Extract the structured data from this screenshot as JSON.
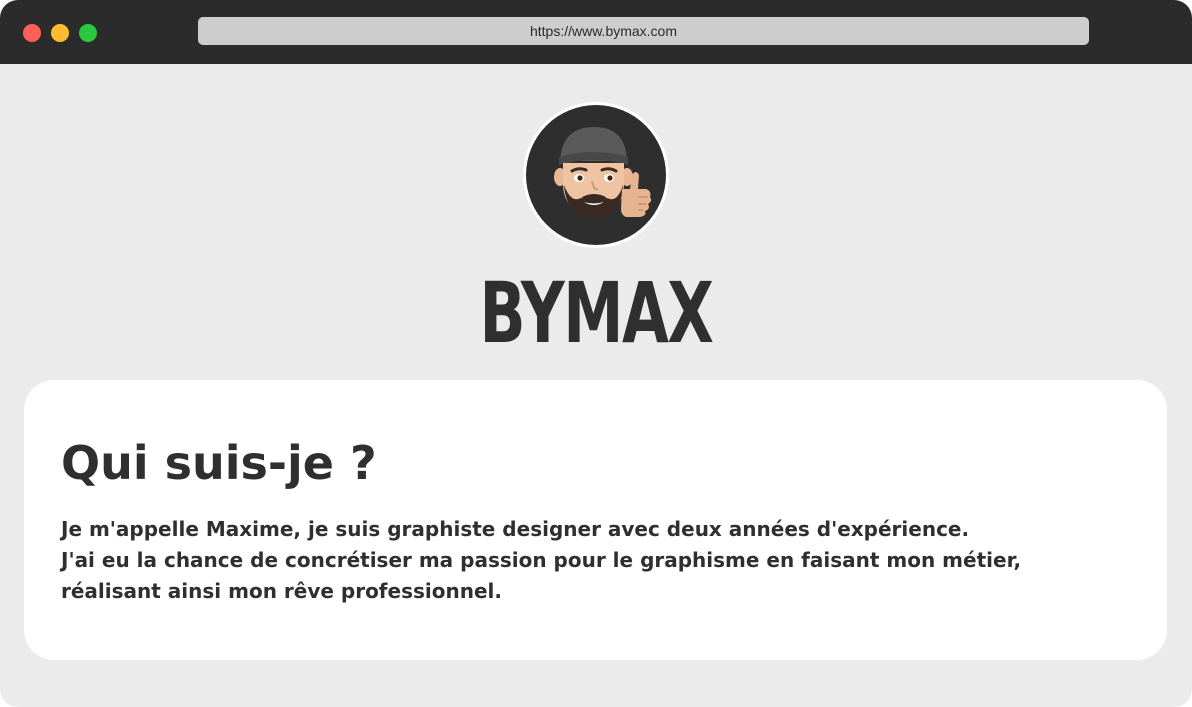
{
  "browser": {
    "url": "https://www.bymax.com"
  },
  "header": {
    "avatar_icon": "memoji-thumbs-up-avatar",
    "brand": "BYMAX"
  },
  "about": {
    "title": "Qui suis-je ?",
    "lines": [
      "Je m'appelle Maxime, je suis graphiste designer avec deux années d'expérience.",
      "J'ai eu la chance de concrétiser ma passion pour le graphisme en faisant mon métier,",
      "réalisant ainsi mon rêve professionnel."
    ]
  },
  "colors": {
    "titlebar": "#2b2b2b",
    "background": "#ebebeb",
    "text": "#2f2f2f",
    "close": "#ff5f57",
    "minimize": "#febc2e",
    "maximize": "#28c840"
  }
}
